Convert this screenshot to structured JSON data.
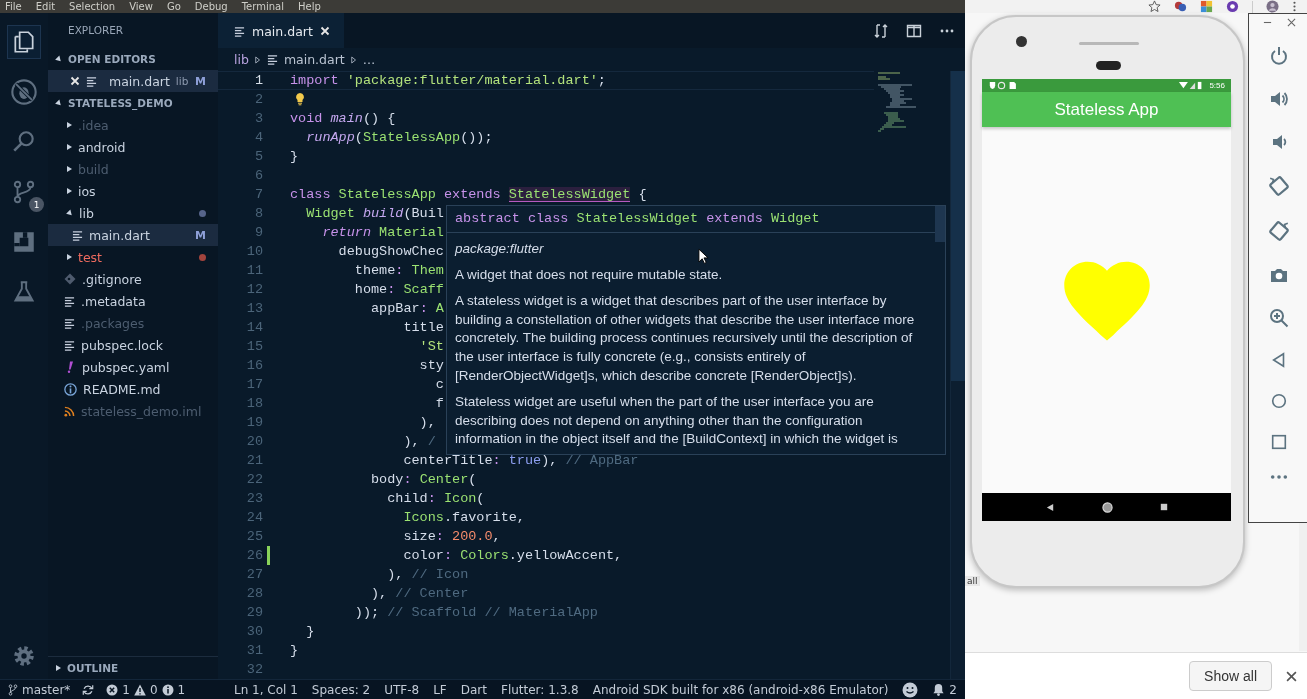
{
  "menu_bar": {
    "items": [
      "File",
      "Edit",
      "Selection",
      "View",
      "Go",
      "Debug",
      "Terminal",
      "Help"
    ]
  },
  "activity_bar": {
    "items": [
      {
        "selected": true
      },
      {
        "selected": false
      },
      {
        "selected": false
      },
      {
        "selected": false,
        "badge": "1"
      },
      {
        "selected": false
      },
      {
        "selected": false
      }
    ]
  },
  "sidebar": {
    "title": "EXPLORER",
    "open_editors": {
      "title": "OPEN EDITORS",
      "expanded": true,
      "items": [
        {
          "name": "main.dart",
          "folder": "lib",
          "badge": "M",
          "selected": true
        }
      ]
    },
    "project": {
      "title": "STATELESS_DEMO",
      "expanded": true,
      "items": [
        {
          "name": ".idea",
          "kind": "folder",
          "expanded": false,
          "selected": false,
          "ignored": true,
          "error": false
        },
        {
          "name": "android",
          "kind": "folder",
          "expanded": false,
          "selected": false,
          "ignored": false,
          "error": false
        },
        {
          "name": "build",
          "kind": "folder",
          "expanded": false,
          "selected": false,
          "ignored": true,
          "error": false
        },
        {
          "name": "ios",
          "kind": "folder",
          "expanded": false,
          "selected": false,
          "ignored": false,
          "error": false
        },
        {
          "name": "lib",
          "kind": "folder",
          "expanded": true,
          "selected": false,
          "ignored": false,
          "error": false,
          "color": "#56648a",
          "children": [
            {
              "name": "main.dart",
              "kind": "text",
              "selected": true,
              "ignored": false,
              "error": false,
              "badge": "M"
            }
          ]
        },
        {
          "name": "test",
          "kind": "folder",
          "expanded": false,
          "selected": false,
          "ignored": false,
          "error": true,
          "color": "#a3443d"
        },
        {
          "name": ".gitignore",
          "kind": "git",
          "selected": false,
          "ignored": false,
          "error": false
        },
        {
          "name": ".metadata",
          "kind": "text",
          "selected": false,
          "ignored": false,
          "error": false
        },
        {
          "name": ".packages",
          "kind": "text",
          "selected": false,
          "ignored": true,
          "error": false
        },
        {
          "name": "pubspec.lock",
          "kind": "text",
          "selected": false,
          "ignored": false,
          "error": false
        },
        {
          "name": "pubspec.yaml",
          "kind": "yaml",
          "selected": false,
          "ignored": false,
          "error": false
        },
        {
          "name": "README.md",
          "kind": "readme",
          "selected": false,
          "ignored": false,
          "error": false
        },
        {
          "name": "stateless_demo.iml",
          "kind": "feed",
          "selected": false,
          "ignored": true,
          "error": false
        }
      ]
    },
    "outline": {
      "title": "OUTLINE",
      "expanded": false
    }
  },
  "editor": {
    "tabs": [
      {
        "label": "main.dart",
        "selected": true
      }
    ],
    "breadcrumb": [
      "lib",
      "main.dart",
      "…"
    ],
    "lines": [
      {
        "number": "1",
        "current": true,
        "modified": false,
        "bulb": false,
        "tokens": [
          {
            "kind": "kw",
            "text": "import"
          },
          {
            "kind": "str",
            "text": " 'package:flutter/material.dart'"
          },
          {
            "kind": "plain",
            "text": ";"
          }
        ]
      },
      {
        "number": "2",
        "current": false,
        "modified": false,
        "bulb": true
      },
      {
        "number": "3",
        "current": false,
        "modified": false,
        "bulb": false,
        "tokens": [
          {
            "kind": "kw",
            "text": "void"
          },
          {
            "kind": "fn",
            "text": " main"
          },
          {
            "kind": "plain",
            "text": "() {"
          }
        ]
      },
      {
        "number": "4",
        "current": false,
        "modified": false,
        "bulb": false,
        "tokens": [
          {
            "kind": "fn",
            "text": "  runApp"
          },
          {
            "kind": "plain",
            "text": "("
          },
          {
            "kind": "type",
            "text": "StatelessApp"
          },
          {
            "kind": "plain",
            "text": "());"
          }
        ]
      },
      {
        "number": "5",
        "current": false,
        "modified": false,
        "bulb": false,
        "tokens": [
          {
            "kind": "plain",
            "text": "}"
          }
        ]
      },
      {
        "number": "6",
        "current": false,
        "modified": false,
        "bulb": false
      },
      {
        "number": "7",
        "current": false,
        "modified": false,
        "bulb": false,
        "tokens": [
          {
            "kind": "kw",
            "text": "class"
          },
          {
            "kind": "type",
            "text": " StatelessApp"
          },
          {
            "kind": "kw",
            "text": " extends "
          },
          {
            "kind": "hl",
            "text": "StatelessWidget"
          },
          {
            "kind": "plain",
            "text": " {"
          }
        ]
      },
      {
        "number": "8",
        "current": false,
        "modified": false,
        "bulb": false,
        "tokens": [
          {
            "kind": "type",
            "text": "  Widget"
          },
          {
            "kind": "fn",
            "text": " build"
          },
          {
            "kind": "plain",
            "text": "(Buil"
          }
        ]
      },
      {
        "number": "9",
        "current": false,
        "modified": false,
        "bulb": false,
        "tokens": [
          {
            "kind": "kwi",
            "text": "    return"
          },
          {
            "kind": "type",
            "text": " Material"
          }
        ]
      },
      {
        "number": "10",
        "current": false,
        "modified": false,
        "bulb": false,
        "tokens": [
          {
            "kind": "plain",
            "text": "      debugShowChec"
          }
        ]
      },
      {
        "number": "11",
        "current": false,
        "modified": false,
        "bulb": false,
        "tokens": [
          {
            "kind": "plain",
            "text": "        theme"
          },
          {
            "kind": "punct",
            "text": ":"
          },
          {
            "kind": "type",
            "text": " Them"
          }
        ]
      },
      {
        "number": "12",
        "current": false,
        "modified": false,
        "bulb": false,
        "tokens": [
          {
            "kind": "plain",
            "text": "        home"
          },
          {
            "kind": "punct",
            "text": ":"
          },
          {
            "kind": "type",
            "text": " Scaff"
          }
        ]
      },
      {
        "number": "13",
        "current": false,
        "modified": false,
        "bulb": false,
        "tokens": [
          {
            "kind": "plain",
            "text": "          appBar"
          },
          {
            "kind": "punct",
            "text": ":"
          },
          {
            "kind": "type",
            "text": " A"
          }
        ]
      },
      {
        "number": "14",
        "current": false,
        "modified": false,
        "bulb": false,
        "tokens": [
          {
            "kind": "plain",
            "text": "              title"
          }
        ]
      },
      {
        "number": "15",
        "current": false,
        "modified": false,
        "bulb": false,
        "tokens": [
          {
            "kind": "str",
            "text": "                'St"
          }
        ]
      },
      {
        "number": "16",
        "current": false,
        "modified": false,
        "bulb": false,
        "tokens": [
          {
            "kind": "plain",
            "text": "                sty"
          }
        ]
      },
      {
        "number": "17",
        "current": false,
        "modified": false,
        "bulb": false,
        "tokens": [
          {
            "kind": "plain",
            "text": "                  c"
          }
        ]
      },
      {
        "number": "18",
        "current": false,
        "modified": false,
        "bulb": false,
        "tokens": [
          {
            "kind": "plain",
            "text": "                  f"
          }
        ]
      },
      {
        "number": "19",
        "current": false,
        "modified": false,
        "bulb": false,
        "tokens": [
          {
            "kind": "plain",
            "text": "                ),"
          }
        ]
      },
      {
        "number": "20",
        "current": false,
        "modified": false,
        "bulb": false,
        "tokens": [
          {
            "kind": "plain",
            "text": "              ),"
          },
          {
            "kind": "comment",
            "text": " /"
          }
        ]
      },
      {
        "number": "21",
        "current": false,
        "modified": false,
        "bulb": false,
        "tokens": [
          {
            "kind": "plain",
            "text": "              centerTitle"
          },
          {
            "kind": "punct",
            "text": ":"
          },
          {
            "kind": "bool",
            "text": " true"
          },
          {
            "kind": "plain",
            "text": "),"
          },
          {
            "kind": "comment",
            "text": " // AppBar"
          }
        ]
      },
      {
        "number": "22",
        "current": false,
        "modified": false,
        "bulb": false,
        "tokens": [
          {
            "kind": "plain",
            "text": "          body"
          },
          {
            "kind": "punct",
            "text": ":"
          },
          {
            "kind": "type",
            "text": " Center"
          },
          {
            "kind": "plain",
            "text": "("
          }
        ]
      },
      {
        "number": "23",
        "current": false,
        "modified": false,
        "bulb": false,
        "tokens": [
          {
            "kind": "plain",
            "text": "            child"
          },
          {
            "kind": "punct",
            "text": ":"
          },
          {
            "kind": "type",
            "text": " Icon"
          },
          {
            "kind": "plain",
            "text": "("
          }
        ]
      },
      {
        "number": "24",
        "current": false,
        "modified": false,
        "bulb": false,
        "tokens": [
          {
            "kind": "type",
            "text": "              Icons"
          },
          {
            "kind": "plain",
            "text": ".favorite,"
          }
        ]
      },
      {
        "number": "25",
        "current": false,
        "modified": false,
        "bulb": false,
        "tokens": [
          {
            "kind": "plain",
            "text": "              size"
          },
          {
            "kind": "punct",
            "text": ":"
          },
          {
            "kind": "num",
            "text": " 200.0"
          },
          {
            "kind": "plain",
            "text": ","
          }
        ]
      },
      {
        "number": "26",
        "current": false,
        "modified": true,
        "bulb": false,
        "tokens": [
          {
            "kind": "plain",
            "text": "              color"
          },
          {
            "kind": "punct",
            "text": ":"
          },
          {
            "kind": "type",
            "text": " Colors"
          },
          {
            "kind": "plain",
            "text": ".yellowAccent,"
          }
        ]
      },
      {
        "number": "27",
        "current": false,
        "modified": false,
        "bulb": false,
        "tokens": [
          {
            "kind": "plain",
            "text": "            ),"
          },
          {
            "kind": "comment",
            "text": " // Icon"
          }
        ]
      },
      {
        "number": "28",
        "current": false,
        "modified": false,
        "bulb": false,
        "tokens": [
          {
            "kind": "plain",
            "text": "          ),"
          },
          {
            "kind": "comment",
            "text": " // Center"
          }
        ]
      },
      {
        "number": "29",
        "current": false,
        "modified": false,
        "bulb": false,
        "tokens": [
          {
            "kind": "plain",
            "text": "        ));"
          },
          {
            "kind": "comment",
            "text": " // Scaffold // MaterialApp"
          }
        ]
      },
      {
        "number": "30",
        "current": false,
        "modified": false,
        "bulb": false,
        "tokens": [
          {
            "kind": "plain",
            "text": "  }"
          }
        ]
      },
      {
        "number": "31",
        "current": false,
        "modified": false,
        "bulb": false,
        "tokens": [
          {
            "kind": "plain",
            "text": "}"
          }
        ]
      },
      {
        "number": "32",
        "current": false,
        "modified": false,
        "bulb": false
      }
    ],
    "hover": {
      "signature": [
        {
          "kind": "kw",
          "text": "abstract"
        },
        {
          "kind": "kw",
          "text": " class"
        },
        {
          "kind": "type",
          "text": " StatelessWidget"
        },
        {
          "kind": "kw",
          "text": " extends"
        },
        {
          "kind": "type",
          "text": " Widget"
        }
      ],
      "source": "package:flutter",
      "paragraphs": [
        "A widget that does not require mutable state.",
        "A stateless widget is a widget that describes part of the user interface by building a constellation of other widgets that describe the user interface more concretely. The building process continues recursively until the description of the user interface is fully concrete (e.g., consists entirely of [RenderObjectWidget]s, which describe concrete [RenderObject]s).",
        "Stateless widget are useful when the part of the user interface you are describing does not depend on anything other than the configuration information in the object itself and the [BuildContext] in which the widget is"
      ]
    }
  },
  "status_bar": {
    "branch": "master*",
    "errors": "1",
    "warnings": "0",
    "infos": "1",
    "items": [
      "Ln 1, Col 1",
      "Spaces: 2",
      "UTF-8",
      "LF",
      "Dart",
      "Flutter: 1.3.8",
      "Android SDK built for x86 (android-x86 Emulator)"
    ],
    "notifications": "2"
  },
  "emulator": {
    "status_time": "5:56",
    "app_title": "Stateless App"
  },
  "browser": {
    "fragment": "all",
    "show_all": "Show all"
  }
}
